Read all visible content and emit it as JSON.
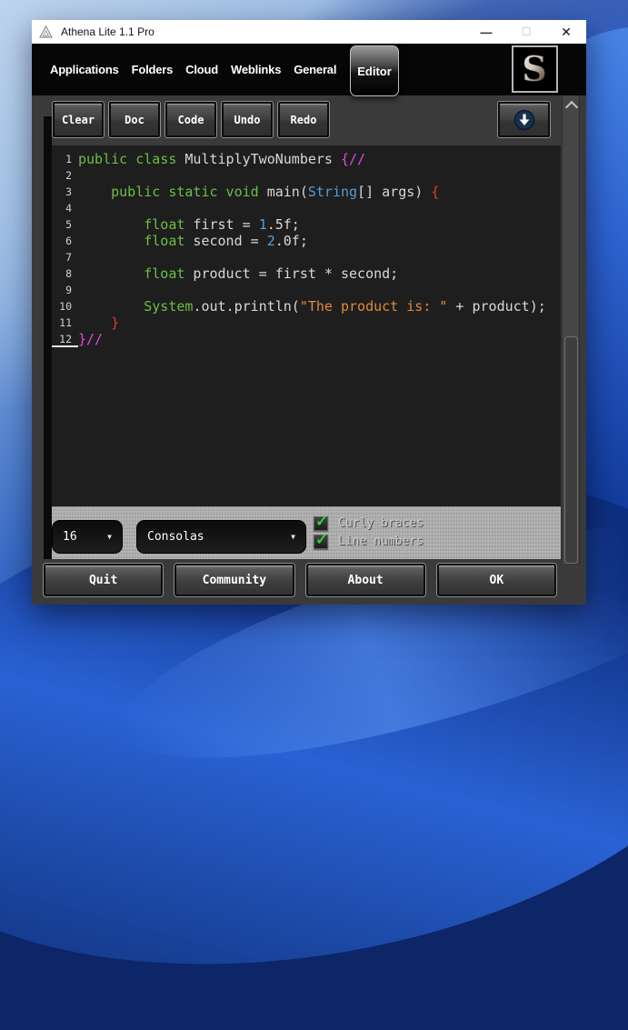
{
  "window": {
    "title": "Athena Lite 1.1 Pro",
    "controls": {
      "minimize": "—",
      "maximize": "☐",
      "close": "✕"
    }
  },
  "menu": {
    "items": [
      "Applications",
      "Folders",
      "Cloud",
      "Weblinks",
      "General"
    ],
    "active_tab": "Editor"
  },
  "toolbar": {
    "buttons": [
      "Clear",
      "Doc",
      "Code",
      "Undo",
      "Redo"
    ]
  },
  "editor": {
    "caret_line": 12,
    "colors": {
      "kw": "#6dbe45",
      "pl": "#d8d8d8",
      "mag": "#de4ade",
      "red": "#dd3a3a",
      "ty": "#569cd6",
      "num": "#569cd6",
      "str": "#e2883a",
      "line_number": "#d0d0d0"
    },
    "lines": [
      {
        "tokens": [
          [
            "kw",
            "public class"
          ],
          [
            "pl",
            " MultiplyTwoNumbers "
          ],
          [
            "mag",
            "{//"
          ]
        ]
      },
      {
        "tokens": []
      },
      {
        "tokens": [
          [
            "pl",
            "    "
          ],
          [
            "kw",
            "public static void"
          ],
          [
            "pl",
            " main("
          ],
          [
            "ty",
            "String"
          ],
          [
            "pl",
            "[] args) "
          ],
          [
            "red",
            "{"
          ]
        ]
      },
      {
        "tokens": []
      },
      {
        "tokens": [
          [
            "pl",
            "        "
          ],
          [
            "kw",
            "float"
          ],
          [
            "pl",
            " first = "
          ],
          [
            "num",
            "1"
          ],
          [
            "pl",
            ".5f;"
          ]
        ]
      },
      {
        "tokens": [
          [
            "pl",
            "        "
          ],
          [
            "kw",
            "float"
          ],
          [
            "pl",
            " second = "
          ],
          [
            "num",
            "2"
          ],
          [
            "pl",
            ".0f;"
          ]
        ]
      },
      {
        "tokens": []
      },
      {
        "tokens": [
          [
            "pl",
            "        "
          ],
          [
            "kw",
            "float"
          ],
          [
            "pl",
            " product = first * second;"
          ]
        ]
      },
      {
        "tokens": []
      },
      {
        "tokens": [
          [
            "pl",
            "        "
          ],
          [
            "kw",
            "System"
          ],
          [
            "pl",
            ".out.println("
          ],
          [
            "str",
            "\"The product is: \""
          ],
          [
            "pl",
            " + product);"
          ]
        ]
      },
      {
        "tokens": [
          [
            "pl",
            "    "
          ],
          [
            "red",
            "}"
          ]
        ]
      },
      {
        "tokens": [
          [
            "mag",
            "}//"
          ]
        ]
      }
    ]
  },
  "bottom_panel": {
    "font_size": "16",
    "font_family": "Consolas",
    "checkboxes": [
      {
        "label": "Curly braces",
        "checked": true
      },
      {
        "label": "Line numbers",
        "checked": true
      }
    ],
    "check_color": "#2fd63a"
  },
  "footer": {
    "buttons": [
      "Quit",
      "Community",
      "About",
      "OK"
    ]
  },
  "accents": {
    "frame": "#3a3a3a",
    "editor_bg": "#1e1e1e",
    "arrow_circle": "#17314e"
  }
}
